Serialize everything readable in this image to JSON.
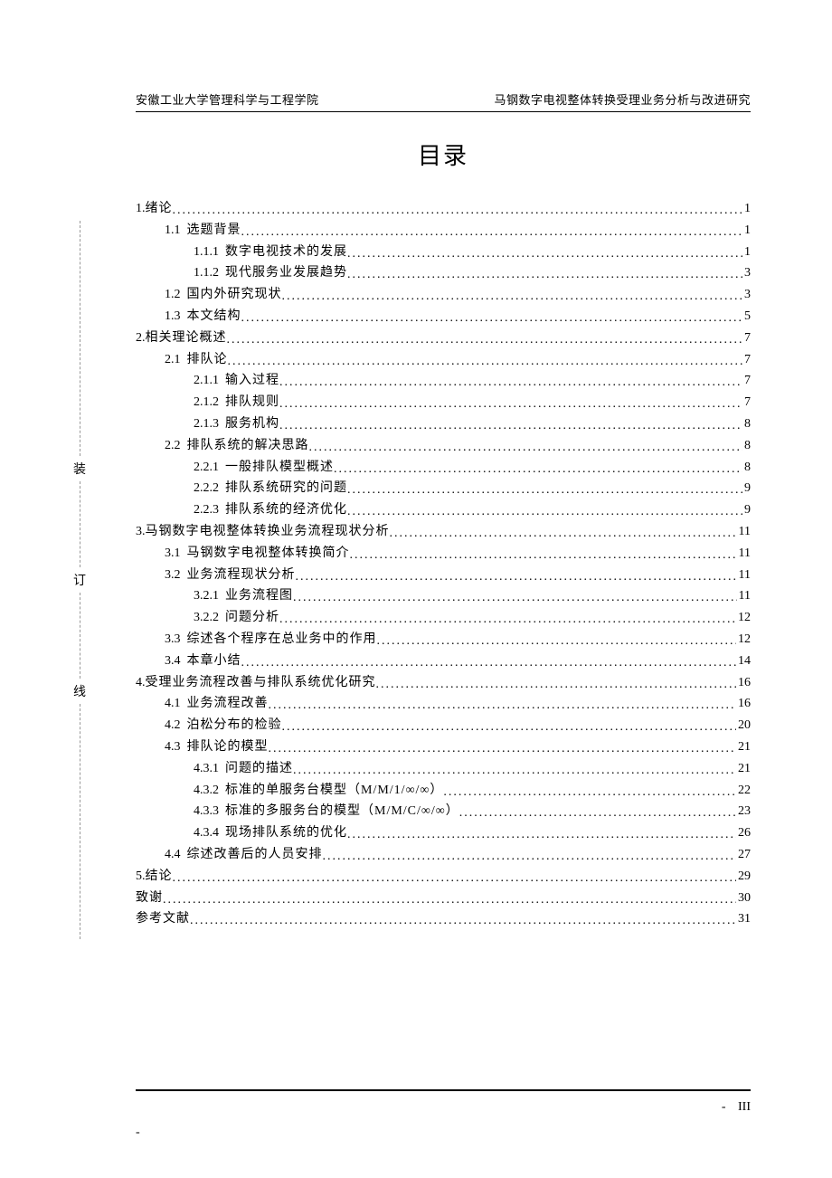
{
  "header": {
    "left": "安徽工业大学管理科学与工程学院",
    "right": "马钢数字电视整体转换受理业务分析与改进研究"
  },
  "title": "目录",
  "binding": {
    "c1": "装",
    "c2": "订",
    "c3": "线"
  },
  "footer": {
    "dash": "-",
    "pageRoman": "III",
    "dashLeft": "-"
  },
  "toc": [
    {
      "indent": 0,
      "num": "1.",
      "label": "绪论",
      "page": "1"
    },
    {
      "indent": 1,
      "num": "1.1",
      "label": "选题背景",
      "page": "1",
      "gap": true
    },
    {
      "indent": 2,
      "num": "1.1.1",
      "label": "数字电视技术的发展",
      "page": "1",
      "gap": true
    },
    {
      "indent": 2,
      "num": "1.1.2",
      "label": "现代服务业发展趋势",
      "page": "3",
      "gap": true
    },
    {
      "indent": 1,
      "num": "1.2",
      "label": "国内外研究现状",
      "page": "3",
      "gap": true
    },
    {
      "indent": 1,
      "num": "1.3",
      "label": "本文结构",
      "page": "5",
      "gap": true
    },
    {
      "indent": 0,
      "num": "2.",
      "label": "相关理论概述",
      "page": "7"
    },
    {
      "indent": 1,
      "num": "2.1",
      "label": "排队论",
      "page": "7",
      "gap": true
    },
    {
      "indent": 2,
      "num": "2.1.1",
      "label": "输入过程",
      "page": "7",
      "gap": true
    },
    {
      "indent": 2,
      "num": "2.1.2",
      "label": "排队规则",
      "page": "7",
      "gap": true
    },
    {
      "indent": 2,
      "num": "2.1.3",
      "label": "服务机构",
      "page": "8",
      "gap": true
    },
    {
      "indent": 1,
      "num": "2.2",
      "label": "排队系统的解决思路",
      "page": "8",
      "gap": true
    },
    {
      "indent": 2,
      "num": "2.2.1",
      "label": "一般排队模型概述",
      "page": "8",
      "gap": true
    },
    {
      "indent": 2,
      "num": "2.2.2",
      "label": "排队系统研究的问题",
      "page": "9",
      "gap": true
    },
    {
      "indent": 2,
      "num": "2.2.3",
      "label": "排队系统的经济优化",
      "page": "9",
      "gap": true
    },
    {
      "indent": 0,
      "num": "3.",
      "label": "马钢数字电视整体转换业务流程现状分析",
      "page": "11"
    },
    {
      "indent": 1,
      "num": "3.1",
      "label": "马钢数字电视整体转换简介",
      "page": "11",
      "gap": true
    },
    {
      "indent": 1,
      "num": "3.2",
      "label": "业务流程现状分析",
      "page": "11",
      "gap": true
    },
    {
      "indent": 2,
      "num": "3.2.1",
      "label": "业务流程图",
      "page": "11",
      "gap": true
    },
    {
      "indent": 2,
      "num": "3.2.2",
      "label": "问题分析",
      "page": "12",
      "gap": true
    },
    {
      "indent": 1,
      "num": "3.3",
      "label": "综述各个程序在总业务中的作用",
      "page": "12",
      "gap": true
    },
    {
      "indent": 1,
      "num": "3.4",
      "label": "本章小结",
      "page": "14",
      "gap": true
    },
    {
      "indent": 0,
      "num": "4.",
      "label": "受理业务流程改善与排队系统优化研究",
      "page": "16"
    },
    {
      "indent": 1,
      "num": "4.1",
      "label": "业务流程改善",
      "page": "16",
      "gap": true
    },
    {
      "indent": 1,
      "num": "4.2",
      "label": "泊松分布的检验",
      "page": "20",
      "gap": true
    },
    {
      "indent": 1,
      "num": "4.3",
      "label": "排队论的模型",
      "page": "21",
      "gap": true
    },
    {
      "indent": 2,
      "num": "4.3.1",
      "label": "问题的描述",
      "page": "21",
      "gap": true
    },
    {
      "indent": 2,
      "num": "4.3.2",
      "label": "标准的单服务台模型（M/M/1/∞/∞）",
      "page": "22",
      "gap": true
    },
    {
      "indent": 2,
      "num": "4.3.3",
      "label": "标准的多服务台的模型（M/M/C/∞/∞）",
      "page": "23",
      "gap": true
    },
    {
      "indent": 2,
      "num": "4.3.4",
      "label": "现场排队系统的优化",
      "page": "26",
      "gap": true
    },
    {
      "indent": 1,
      "num": "4.4",
      "label": "综述改善后的人员安排",
      "page": "27",
      "gap": true
    },
    {
      "indent": 0,
      "num": "5.",
      "label": "结论",
      "page": "29"
    },
    {
      "indent": 0,
      "num": "",
      "label": "致谢",
      "page": "30"
    },
    {
      "indent": 0,
      "num": "",
      "label": "参考文献",
      "page": "31"
    }
  ]
}
